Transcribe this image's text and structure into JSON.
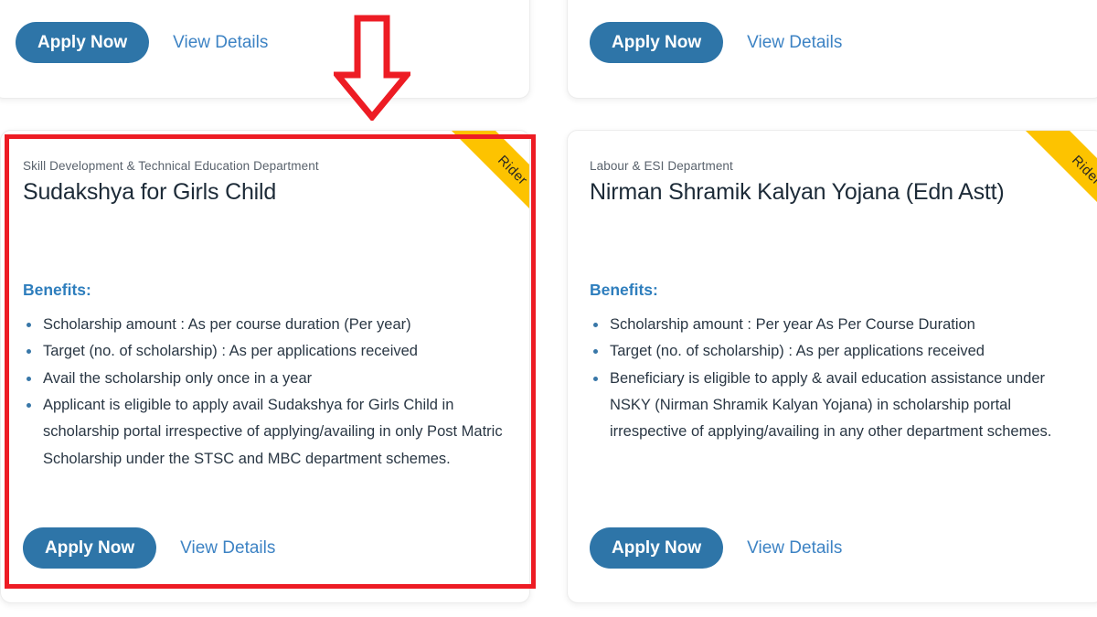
{
  "page": {
    "background_color": "#ffffff",
    "accent_blue": "#2e75a8",
    "link_blue": "#3d83c4",
    "benefits_blue": "#2e7ebd",
    "ribbon_yellow": "#fdc300",
    "annotation_red": "#ed1c24",
    "text_dark": "#2a3744",
    "dept_gray": "#59626c"
  },
  "common": {
    "apply_label": "Apply Now",
    "details_label": "View Details",
    "benefits_label": "Benefits:",
    "ribbon_label": "Rider"
  },
  "cards": {
    "top_left": {
      "apply_label": "Apply Now",
      "details_label": "View Details"
    },
    "top_right": {
      "apply_label": "Apply Now",
      "details_label": "View Details"
    },
    "bottom_left": {
      "department": "Skill Development & Technical Education Department",
      "title": "Sudakshya for Girls Child",
      "ribbon": "Rider",
      "benefits_label": "Benefits:",
      "benefits": [
        "Scholarship amount : As per course duration (Per year)",
        "Target (no. of scholarship) : As per applications received",
        "Avail the scholarship only once in a year",
        "Applicant is eligible to apply avail Sudakshya for Girls Child in scholarship portal irrespective of applying/availing in only Post Matric Scholarship under the STSC and MBC department schemes."
      ],
      "apply_label": "Apply Now",
      "details_label": "View Details",
      "highlighted": "true"
    },
    "bottom_right": {
      "department": "Labour & ESI Department",
      "title": "Nirman Shramik Kalyan Yojana (Edn Astt)",
      "ribbon": "Rider",
      "benefits_label": "Benefits:",
      "benefits": [
        "Scholarship amount : Per year As Per Course Duration",
        "Target (no. of scholarship) : As per applications received",
        "Beneficiary is eligible to apply & avail education assistance under NSKY (Nirman Shramik Kalyan Yojana) in scholarship portal irrespective of applying/availing in any other department schemes."
      ],
      "apply_label": "Apply Now",
      "details_label": "View Details"
    }
  },
  "annotations": {
    "arrow": {
      "name": "down-arrow-annotation",
      "color": "#ed1c24"
    },
    "box": {
      "name": "highlight-box-annotation",
      "color": "#ed1c24"
    }
  }
}
